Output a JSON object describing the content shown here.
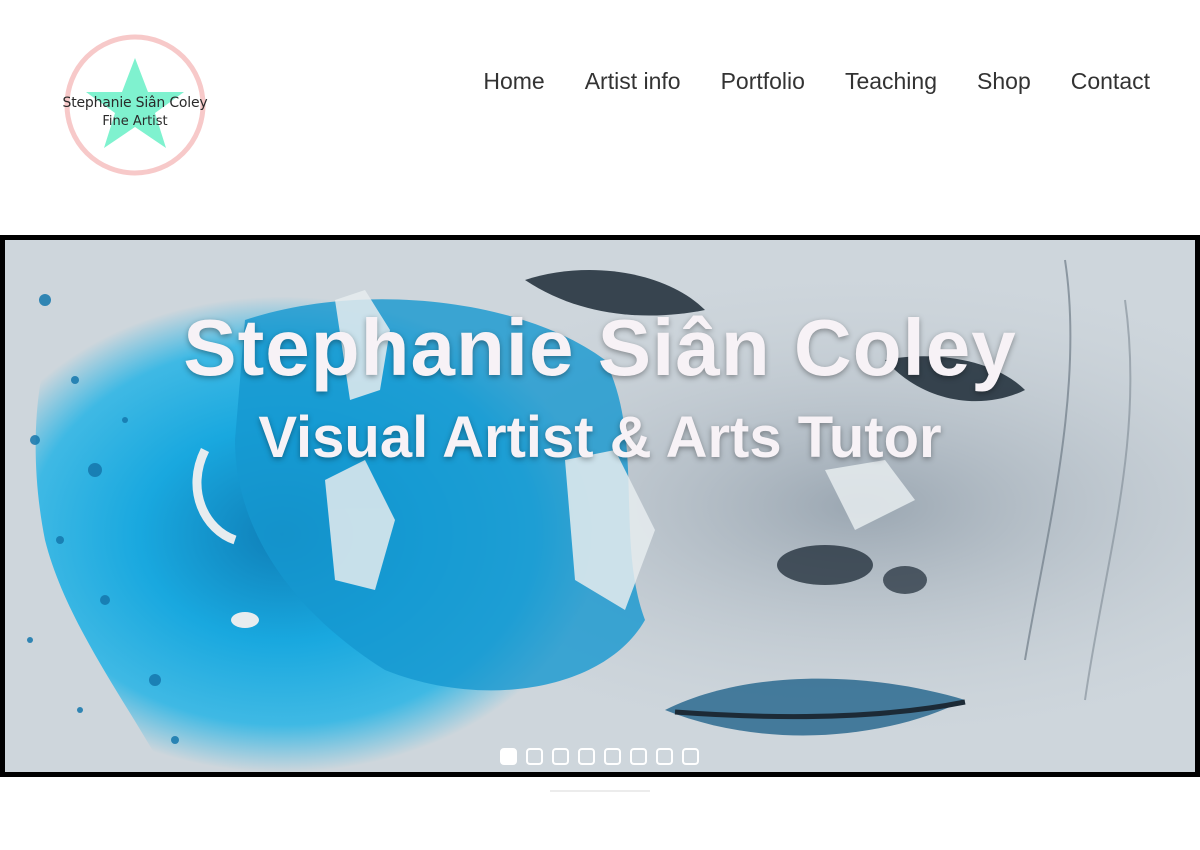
{
  "logo": {
    "name": "Stephanie Siân Coley",
    "subtitle": "Fine Artist",
    "colors": {
      "ring": "#f7c9c9",
      "star": "#7ff2cf"
    }
  },
  "nav": {
    "items": [
      {
        "label": "Home"
      },
      {
        "label": "Artist info"
      },
      {
        "label": "Portfolio"
      },
      {
        "label": "Teaching"
      },
      {
        "label": "Shop"
      },
      {
        "label": "Contact"
      }
    ]
  },
  "hero": {
    "title": "Stephanie Siân Coley",
    "subtitle": "Visual Artist & Arts Tutor",
    "image_description": "watercolour face with blue ink splash",
    "slide_count": 8,
    "active_slide": 1,
    "colors": {
      "accent_blue": "#18a9df",
      "ink": "#1c2a36"
    }
  }
}
